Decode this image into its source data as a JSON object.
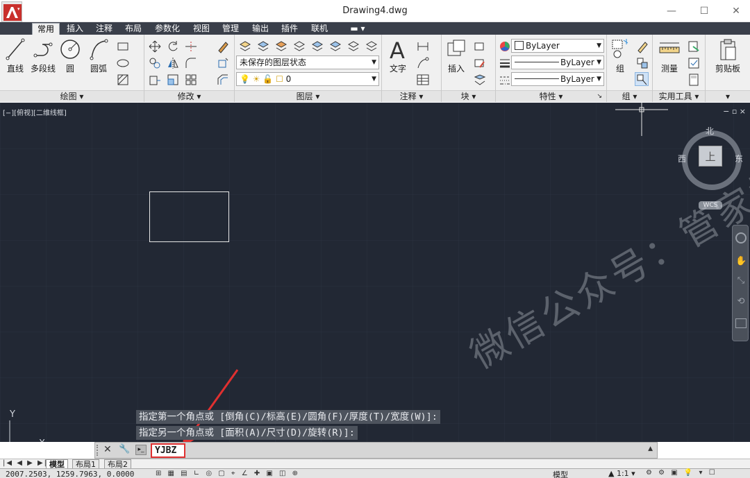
{
  "window": {
    "title": "Drawing4.dwg",
    "minimize": "—",
    "maximize": "☐",
    "close": "✕"
  },
  "ribbon_tabs": [
    "常用",
    "插入",
    "注释",
    "布局",
    "参数化",
    "视图",
    "管理",
    "输出",
    "插件",
    "联机"
  ],
  "draw_panel": {
    "title": "绘图 ▾",
    "tools": [
      "直线",
      "多段线",
      "圆",
      "圆弧"
    ]
  },
  "modify_panel": {
    "title": "修改 ▾"
  },
  "layer_panel": {
    "title": "图层 ▾",
    "layer_state": "未保存的图层状态",
    "current_layer": "0"
  },
  "annotation_panel": {
    "title": "注释 ▾",
    "text_tool": "文字"
  },
  "block_panel": {
    "title": "块 ▾",
    "insert_tool": "插入"
  },
  "properties_panel": {
    "title": "特性 ▾",
    "color": "ByLayer",
    "linetype": "ByLayer",
    "lineweight": "ByLayer"
  },
  "group_panel": {
    "title": "组 ▾",
    "group_tool": "组"
  },
  "utilities_panel": {
    "title": "实用工具 ▾",
    "measure_tool": "测量"
  },
  "clipboard_panel": {
    "title": "▾",
    "paste_tool": "剪贴板"
  },
  "viewport": {
    "label": "[−][俯视][二维线框]",
    "controls": "− ▫ ×"
  },
  "viewcube": {
    "north": "北",
    "west": "西",
    "east": "东",
    "top": "上",
    "wcs": "WCS"
  },
  "watermark": "微信公众号：管家插件",
  "ucs": {
    "y": "Y",
    "x": "X"
  },
  "command_history": [
    "指定第一个角点或 [倒角(C)/标高(E)/圆角(F)/厚度(T)/宽度(W)]:",
    "指定另一个角点或 [面积(A)/尺寸(D)/旋转(R)]:"
  ],
  "command_input": "YJBZ",
  "layout_tabs": [
    "模型",
    "布局1",
    "布局2"
  ],
  "status": {
    "coordinates": "2007.2503, 1259.7963, 0.0000",
    "model_label": "模型",
    "scale": "1:1"
  },
  "colors": {
    "canvas": "#222834",
    "accent_red": "#e03030",
    "tab_bar": "#3a3f4a"
  }
}
